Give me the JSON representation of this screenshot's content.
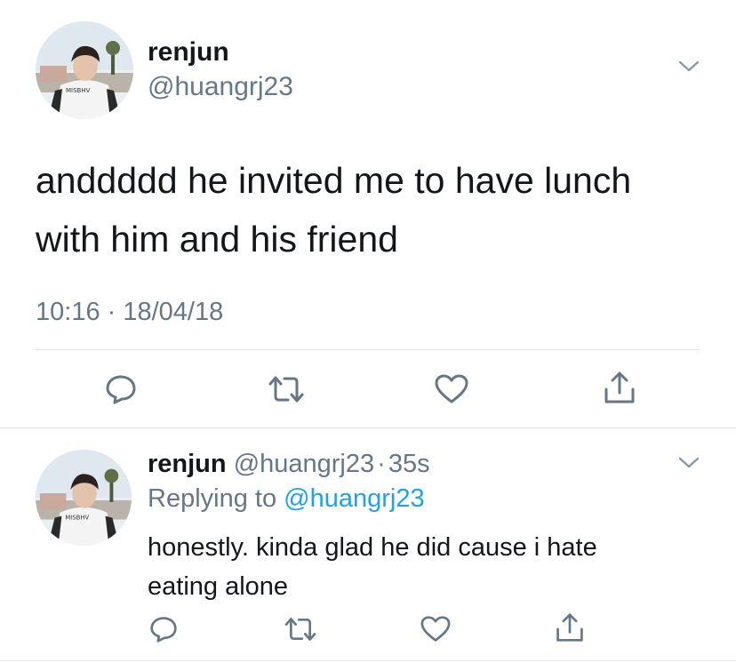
{
  "main_tweet": {
    "display_name": "renjun",
    "handle": "@huangrj23",
    "text_line1": "anddddd he invited me to have lunch",
    "text_line2": "with him and his friend",
    "timestamp": "10:16 · 18/04/18",
    "avatar_shirt_text": "MISBHV",
    "actions": [
      "reply-icon",
      "retweet-icon",
      "like-icon",
      "share-icon"
    ]
  },
  "reply_tweet": {
    "display_name": "renjun",
    "handle": "@huangrj23",
    "dot": "·",
    "age": "35s",
    "replying_prefix": "Replying to",
    "replying_handle": "@huangrj23",
    "text_line1": "honestly. kinda glad he did cause i hate",
    "text_line2": "eating alone",
    "avatar_shirt_text": "MISBHV",
    "actions": [
      "reply-icon",
      "retweet-icon",
      "like-icon",
      "share-icon"
    ]
  },
  "colors": {
    "text": "#14171a",
    "secondary": "#657786",
    "link": "#1da1f2",
    "divider": "#e1e8ed"
  }
}
